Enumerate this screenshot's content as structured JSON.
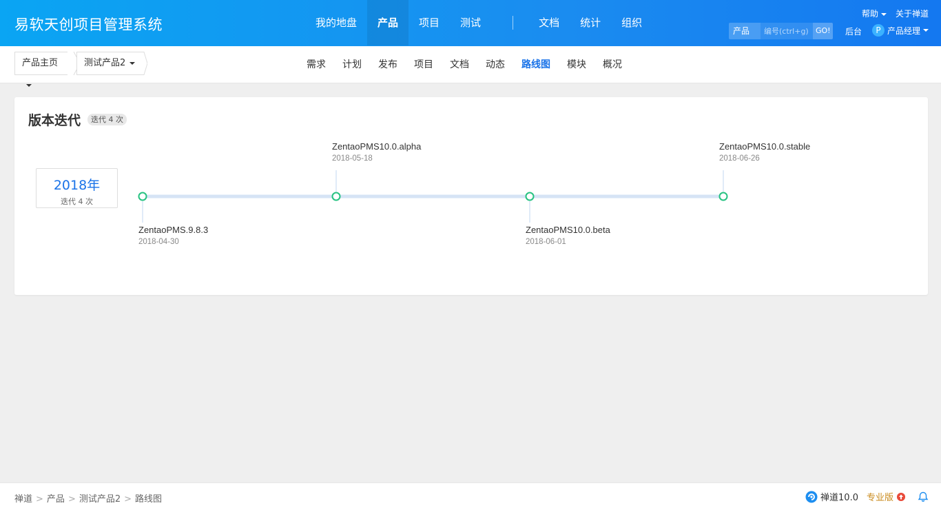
{
  "header": {
    "app_title": "易软天创项目管理系统",
    "nav": [
      {
        "label": "我的地盘",
        "active": false
      },
      {
        "label": "产品",
        "active": true
      },
      {
        "label": "项目",
        "active": false
      },
      {
        "label": "测试",
        "active": false
      },
      {
        "label": "文档",
        "active": false
      },
      {
        "label": "统计",
        "active": false
      },
      {
        "label": "组织",
        "active": false
      }
    ],
    "help_label": "帮助",
    "about_label": "关于禅道",
    "search_type": "产品",
    "search_placeholder": "编号(ctrl+g)",
    "go_label": "GO!",
    "backend_label": "后台",
    "avatar_letter": "P",
    "user_name": "产品经理"
  },
  "subbar": {
    "home_label": "产品主页",
    "product_label": "测试产品2",
    "items": [
      {
        "label": "需求",
        "active": false
      },
      {
        "label": "计划",
        "active": false
      },
      {
        "label": "发布",
        "active": false
      },
      {
        "label": "项目",
        "active": false
      },
      {
        "label": "文档",
        "active": false
      },
      {
        "label": "动态",
        "active": false
      },
      {
        "label": "路线图",
        "active": true
      },
      {
        "label": "模块",
        "active": false
      },
      {
        "label": "概况",
        "active": false
      }
    ]
  },
  "panel": {
    "title": "版本迭代",
    "badge": "迭代 4 次",
    "year": "2018年",
    "year_count": "迭代 4 次",
    "releases": [
      {
        "name": "ZentaoPMS.9.8.3",
        "date": "2018-04-30",
        "side": "below"
      },
      {
        "name": "ZentaoPMS10.0.alpha",
        "date": "2018-05-18",
        "side": "above"
      },
      {
        "name": "ZentaoPMS10.0.beta",
        "date": "2018-06-01",
        "side": "below"
      },
      {
        "name": "ZentaoPMS10.0.stable",
        "date": "2018-06-26",
        "side": "above"
      }
    ]
  },
  "footer": {
    "crumbs": [
      "禅道",
      "产品",
      "测试产品2",
      "路线图"
    ],
    "version": "禅道10.0",
    "pro_label": "专业版"
  },
  "colors": {
    "header_start": "#0aa5f3",
    "header_end": "#1478f0",
    "accent": "#1a73e8",
    "node": "#26c281",
    "track": "#d6e4f5",
    "pro": "#c98a1b"
  }
}
